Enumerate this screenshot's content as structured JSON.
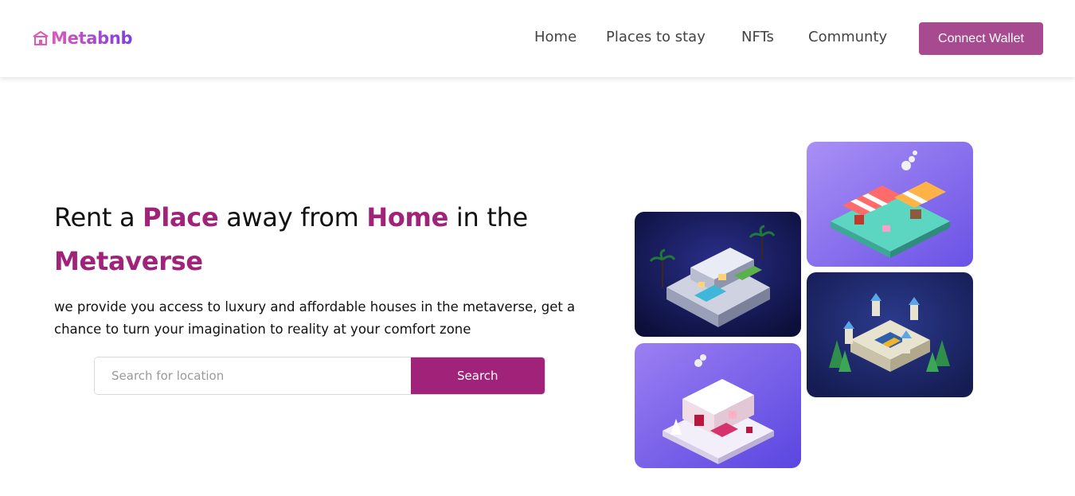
{
  "navbar": {
    "logo_text": "Metabnb",
    "logo_icon": "house-icon",
    "links": [
      "Home",
      "Places to stay",
      "NFTs",
      "Communty"
    ],
    "connect_button": "Connect Wallet"
  },
  "hero": {
    "headline": {
      "part1": "Rent a ",
      "accent1": "Place",
      "part2": " away from ",
      "accent2": "Home",
      "part3": " in the ",
      "accent3": "Metaverse"
    },
    "description": "we provide you access to luxury and affordable houses in the metaverse, get a chance to turn your imagination to reality at your comfort zone",
    "search": {
      "placeholder": "Search for location",
      "button_label": "Search"
    }
  },
  "gallery": {
    "items": [
      {
        "name": "modern-villa-illustration"
      },
      {
        "name": "market-stall-illustration"
      },
      {
        "name": "castle-fort-illustration"
      },
      {
        "name": "snow-cabin-illustration"
      }
    ]
  },
  "colors": {
    "accent": "#a02279",
    "button": "#a74a90",
    "logo_gradient_start": "#e058b6",
    "logo_gradient_end": "#7b3fe4"
  }
}
